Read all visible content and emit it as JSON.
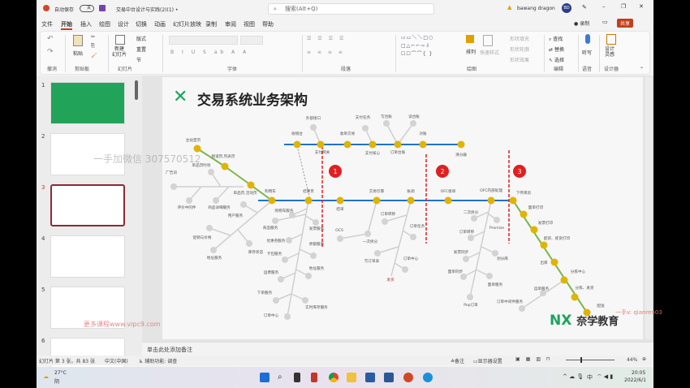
{
  "titlebar": {
    "autosave_label": "自动保存",
    "autosave_state": "关",
    "doc_title": "交易中台设计与实践(2)(1) •",
    "search_placeholder": "搜索(Alt+Q)",
    "user_name": "bawang dragon",
    "avatar_initials": "BD"
  },
  "tabs": [
    "文件",
    "开始",
    "插入",
    "绘图",
    "设计",
    "切换",
    "动画",
    "幻灯片放映",
    "录制",
    "审阅",
    "视图",
    "帮助"
  ],
  "tab_actions": {
    "record": "录制",
    "share": "共享"
  },
  "ribbon": {
    "groups": [
      "撤消",
      "剪贴板",
      "幻灯片",
      "字体",
      "段落",
      "绘图",
      "编辑",
      "语音",
      "设计器"
    ],
    "paste": "粘贴",
    "new_slide": "新建\n幻灯片",
    "layout": "版式",
    "reset": "重置",
    "section": "节",
    "arrange": "排列",
    "quick_styles": "快速样式",
    "shape_fill": "形状填充",
    "shape_outline": "形状轮廓",
    "shape_effects": "形状效果",
    "find": "查找",
    "replace": "替换",
    "select": "选择",
    "dictate": "听写",
    "designer": "设计\n灵感"
  },
  "thumbnails": [
    {
      "num": "1"
    },
    {
      "num": "2"
    },
    {
      "num": "3",
      "selected": true
    },
    {
      "num": "4"
    },
    {
      "num": "5"
    },
    {
      "num": "6"
    }
  ],
  "slide": {
    "title": "交易系统业务架构",
    "markers": [
      "1",
      "2",
      "3"
    ],
    "nodes": [
      "收银台",
      "支付网关",
      "收单交易",
      "支付核心",
      "订单台账",
      "对账",
      "清分器",
      "外部接口",
      "支付任务",
      "写台账",
      "读台账",
      "购物车",
      "结算页",
      "结单",
      "交易引擎",
      "账调",
      "OFC接单",
      "OFC内部处理",
      "下传库房",
      "主站首页",
      "频道页,列表页",
      "单品页,活动页",
      "面单打印",
      "发票打印",
      "配货、拣货打印",
      "出库",
      "分拣中心",
      "分拣、发货",
      "配送",
      "单品页时效",
      "广告词",
      "评价中的件",
      "商品详细服务",
      "用户服务",
      "促销与价格",
      "地址服务",
      "库存状态",
      "购物车服务",
      "商品服务",
      "发票服务",
      "优惠券服务",
      "余额服务",
      "卡包服务",
      "地址服务",
      "运费服务",
      "下单服务",
      "实时库存服务",
      "订单中心",
      "OCS",
      "一次拆分",
      "订单转移",
      "订单任务",
      "写订单表",
      "订单中心",
      "发货",
      "二次拆分",
      "Promise",
      "订单转移",
      "划分库",
      "发票同步",
      "面单同步",
      "面单服务",
      "Pop订单",
      "运单服务",
      "订单中间件服务"
    ],
    "logo_text": "奈学教育",
    "colors": {
      "main_line": "#1f73c9",
      "green_line": "#7ab648",
      "station": "#e0b400",
      "branch": "#cfcfcf",
      "marker": "#e02020"
    }
  },
  "watermarks": [
    "一手加微信  307570512",
    "更多课程www.vipc9.com",
    "一手v: qianren03"
  ],
  "notes_placeholder": "单击此处添加备注",
  "status": {
    "slide_info": "幻灯片 第 3 张，共 83 张",
    "language": "中文(中国)",
    "accessibility": "辅助功能: 调查",
    "notes": "备注",
    "display_settings": "显示器设置",
    "zoom": "44%"
  },
  "taskbar": {
    "weather_temp": "27°C",
    "weather_desc": "阴",
    "ime": "中",
    "time": "20:05",
    "date": "2022/6/1"
  }
}
